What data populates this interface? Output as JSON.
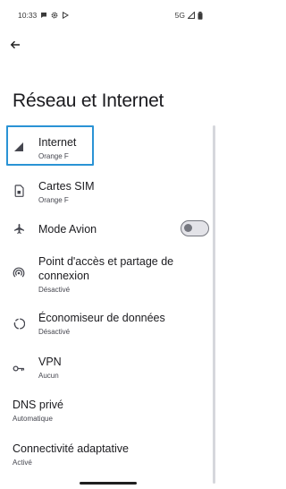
{
  "status_bar": {
    "time": "10:33",
    "network": "5G",
    "left_icons": [
      "message-icon",
      "gear-icon",
      "play-store-icon"
    ],
    "right_icons": [
      "signal-icon",
      "battery-icon"
    ]
  },
  "header": {
    "back_icon": "arrow-back-icon",
    "title": "Réseau et Internet"
  },
  "items": [
    {
      "icon": "signal-icon",
      "title": "Internet",
      "summary": "Orange F",
      "focused": true
    },
    {
      "icon": "sim-card-icon",
      "title": "Cartes SIM",
      "summary": "Orange F"
    },
    {
      "icon": "airplane-icon",
      "title": "Mode Avion",
      "summary": "",
      "toggle": false
    },
    {
      "icon": "hotspot-icon",
      "title": "Point d'accès et partage de connexion",
      "summary": "Désactivé"
    },
    {
      "icon": "data-saver-icon",
      "title": "Économiseur de données",
      "summary": "Désactivé"
    },
    {
      "icon": "vpn-key-icon",
      "title": "VPN",
      "summary": "Aucun"
    },
    {
      "icon": "",
      "title": "DNS privé",
      "summary": "Automatique"
    },
    {
      "icon": "",
      "title": "Connectivité adaptative",
      "summary": "Activé"
    }
  ],
  "colors": {
    "focus_outline": "#2a93d5",
    "text_primary": "#1b1b1f",
    "text_secondary": "#45464f"
  }
}
